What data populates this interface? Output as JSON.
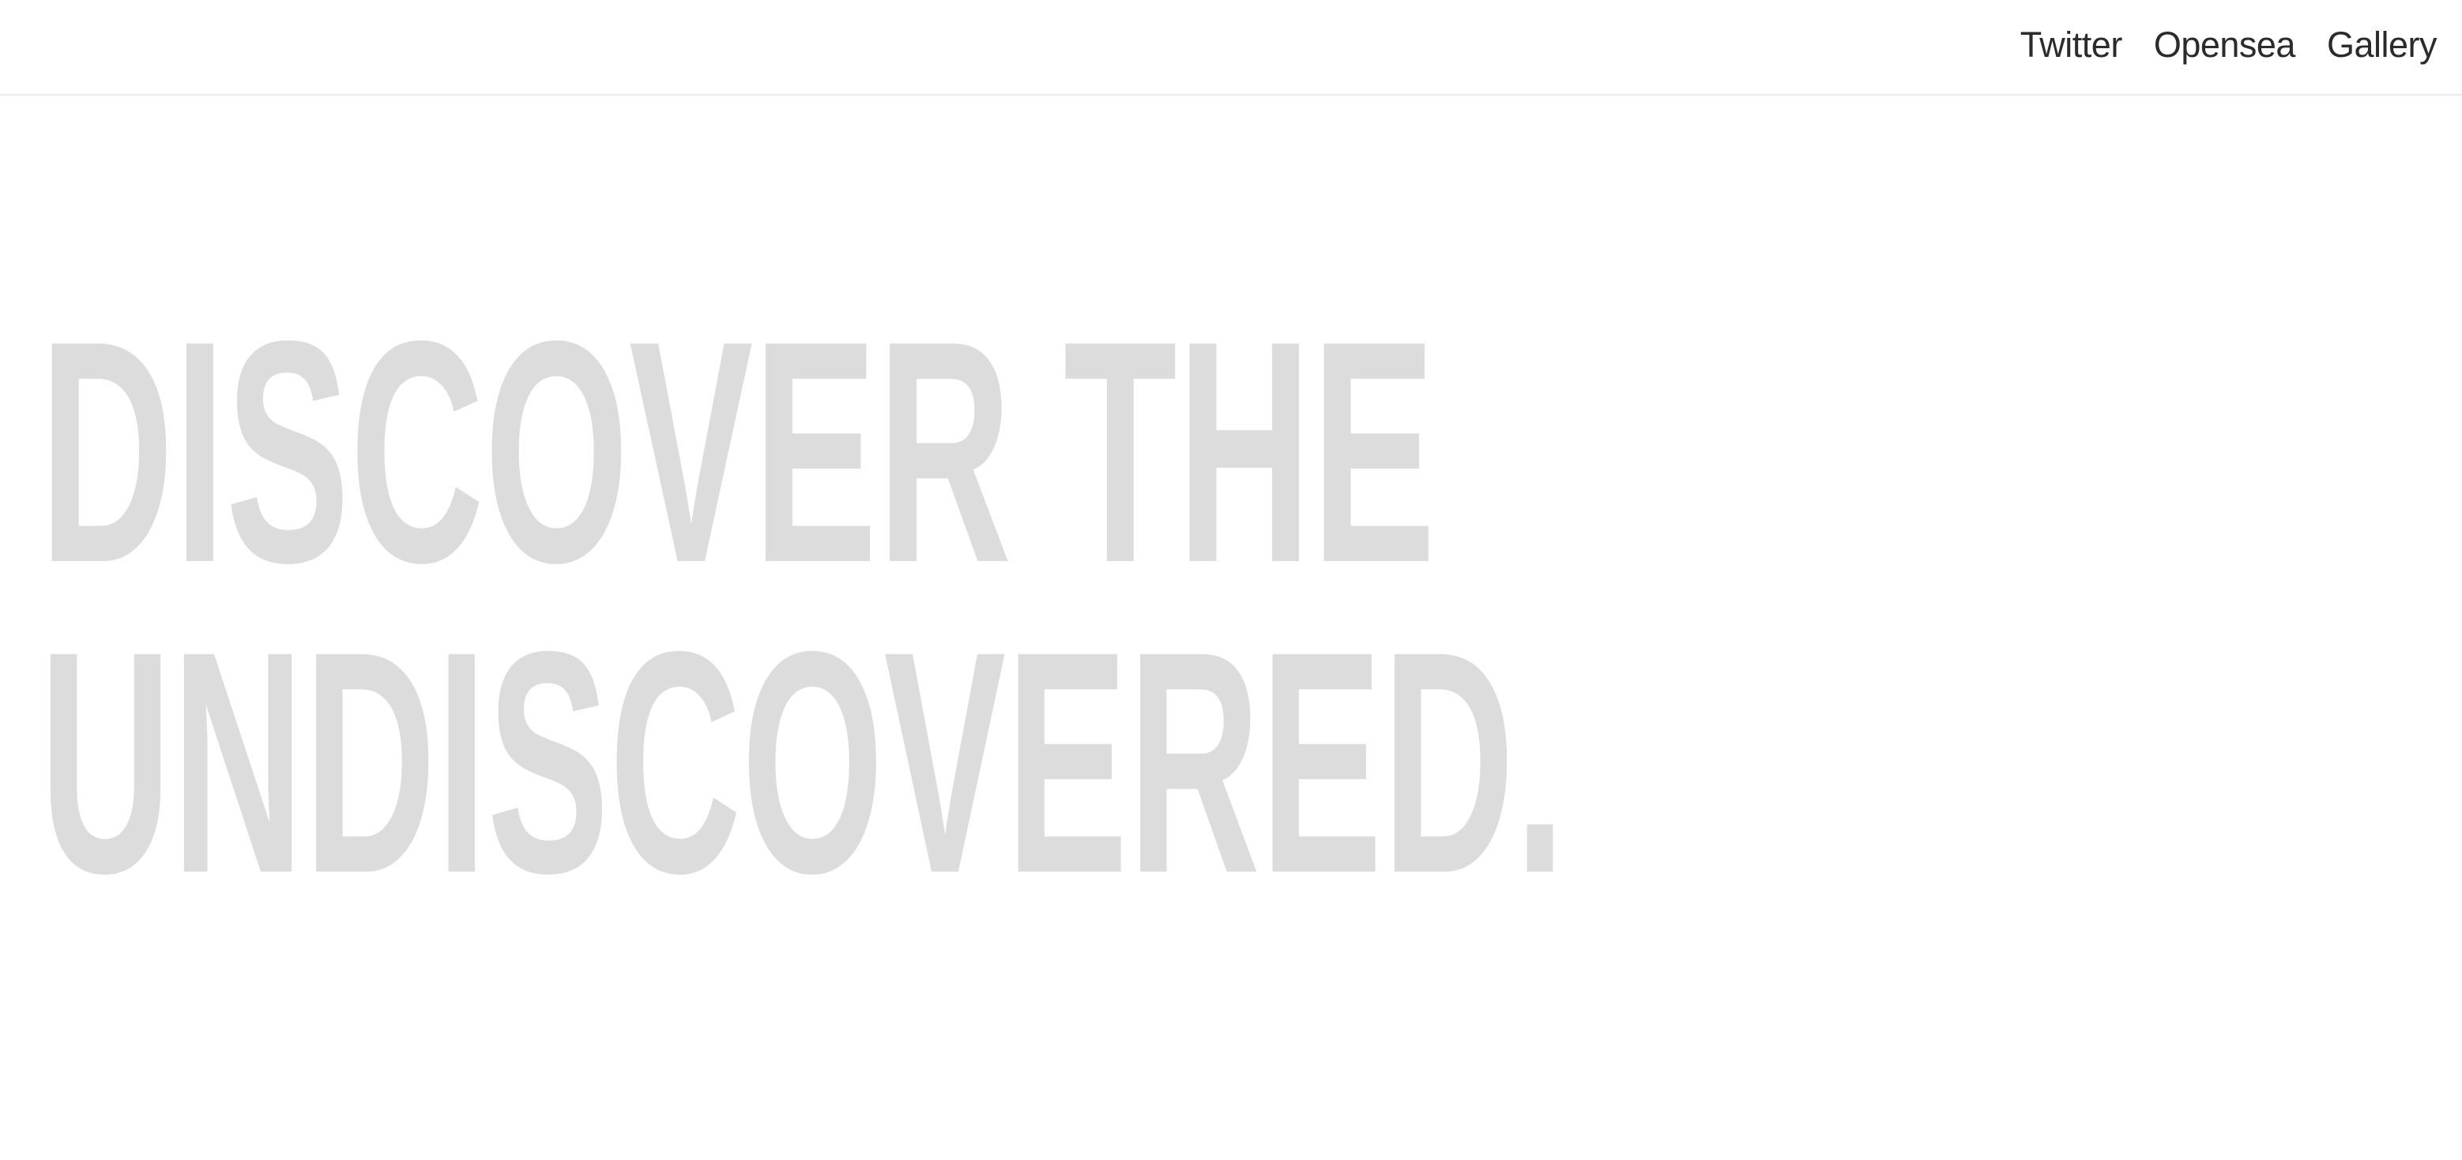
{
  "nav": {
    "links": [
      {
        "label": "Twitter"
      },
      {
        "label": "Opensea"
      },
      {
        "label": "Gallery"
      }
    ]
  },
  "hero": {
    "line1": "DISCOVER THE",
    "line2": "UNDISCOVERED."
  },
  "colors": {
    "hero_text": "#dcdcdc",
    "nav_text": "#2b2b2b",
    "divider": "#ebebeb",
    "background": "#ffffff"
  }
}
